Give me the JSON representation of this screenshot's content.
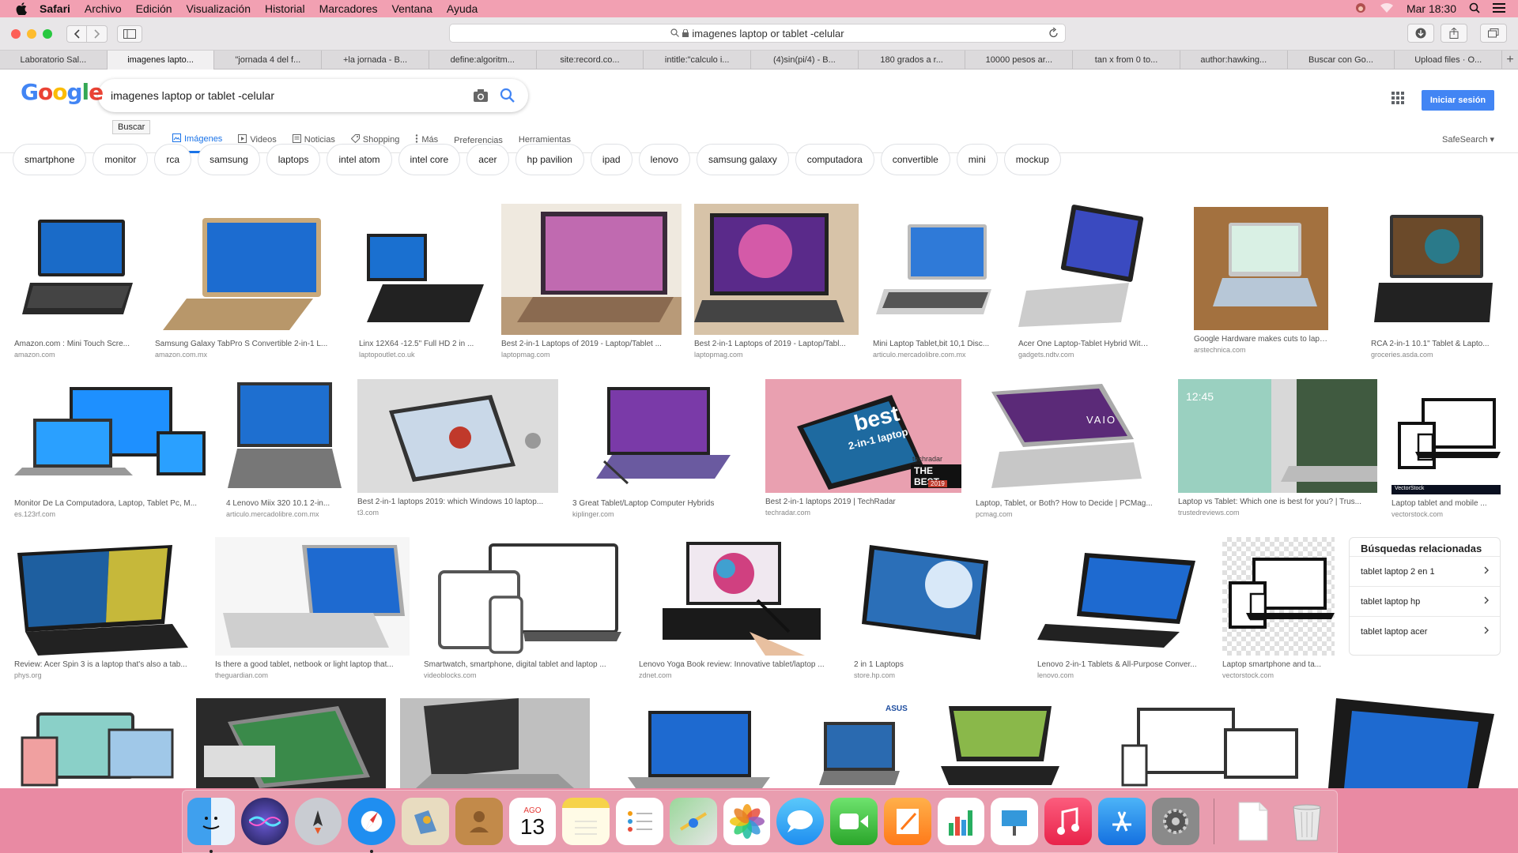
{
  "menubar": {
    "app": "Safari",
    "items": [
      "Archivo",
      "Edición",
      "Visualización",
      "Historial",
      "Marcadores",
      "Ventana",
      "Ayuda"
    ],
    "clock": "Mar 18:30"
  },
  "browser": {
    "address": "imagenes laptop or tablet -celular",
    "tabs": [
      "Laboratorio Sal...",
      "imagenes lapto...",
      "\"jornada 4 del f...",
      "+la jornada - B...",
      "define:algoritm...",
      "site:record.co...",
      "intitle:\"calculo i...",
      "(4)sin(pi/4) - B...",
      "180 grados a r...",
      "10000 pesos ar...",
      "tan x from 0 to...",
      "author:hawking...",
      "Buscar con Go...",
      "Upload files · O..."
    ]
  },
  "google": {
    "logo_letters": [
      "G",
      "o",
      "o",
      "g",
      "l",
      "e"
    ],
    "query": "imagenes laptop or tablet -celular",
    "tooltip": "Buscar",
    "nav_tabs": [
      "Imágenes",
      "Videos",
      "Noticias",
      "Shopping",
      "Más",
      "Preferencias",
      "Herramientas"
    ],
    "signin": "Iniciar sesión",
    "safesearch": "SafeSearch ▾"
  },
  "chips": [
    "smartphone",
    "monitor",
    "rca",
    "samsung",
    "laptops",
    "intel atom",
    "intel core",
    "acer",
    "hp pavilion",
    "ipad",
    "lenovo",
    "samsung galaxy",
    "computadora",
    "convertible",
    "mini",
    "mockup"
  ],
  "results": [
    {
      "caption": "Amazon.com : Mini Touch Scre...",
      "source": "amazon.com"
    },
    {
      "caption": "Samsung Galaxy TabPro S Convertible 2-in-1 L...",
      "source": "amazon.com.mx"
    },
    {
      "caption": "Linx 12X64 -12.5\" Full HD 2 in ...",
      "source": "laptopoutlet.co.uk"
    },
    {
      "caption": "Best 2-in-1 Laptops of 2019 - Laptop/Tablet ...",
      "source": "laptopmag.com"
    },
    {
      "caption": "Best 2-in-1 Laptops of 2019 - Laptop/Tabl...",
      "source": "laptopmag.com"
    },
    {
      "caption": "Mini Laptop Tablet,bit 10,1 Disc...",
      "source": "articulo.mercadolibre.com.mx"
    },
    {
      "caption": "Acer One Laptop-Tablet Hybrid With Win...",
      "source": "gadgets.ndtv.com"
    },
    {
      "caption": "Google Hardware makes cuts to laptop a...",
      "source": "arstechnica.com"
    },
    {
      "caption": "RCA 2-in-1 10.1\" Tablet & Lapto...",
      "source": "groceries.asda.com"
    },
    {
      "caption": "Monitor De La Computadora, Laptop, Tablet Pc, M...",
      "source": "es.123rf.com"
    },
    {
      "caption": "4 Lenovo Miix 320 10.1 2-in...",
      "source": "articulo.mercadolibre.com.mx"
    },
    {
      "caption": "Best 2-in-1 laptops 2019: which Windows 10 laptop...",
      "source": "t3.com"
    },
    {
      "caption": "3 Great Tablet/Laptop Computer Hybrids",
      "source": "kiplinger.com"
    },
    {
      "caption": "Best 2-in-1 laptops 2019 | TechRadar",
      "source": "techradar.com"
    },
    {
      "caption": "Laptop, Tablet, or Both? How to Decide | PCMag...",
      "source": "pcmag.com"
    },
    {
      "caption": "Laptop vs Tablet: Which one is best for you? | Trus...",
      "source": "trustedreviews.com"
    },
    {
      "caption": "Laptop tablet and mobile ...",
      "source": "vectorstock.com"
    },
    {
      "caption": "Review: Acer Spin 3 is a laptop that's also a tab...",
      "source": "phys.org"
    },
    {
      "caption": "Is there a good tablet, netbook or light laptop that...",
      "source": "theguardian.com"
    },
    {
      "caption": "Smartwatch, smartphone, digital tablet and laptop ...",
      "source": "videoblocks.com"
    },
    {
      "caption": "Lenovo Yoga Book review: Innovative tablet/laptop ...",
      "source": "zdnet.com"
    },
    {
      "caption": "2 in 1 Laptops",
      "source": "store.hp.com"
    },
    {
      "caption": "Lenovo 2-in-1 Tablets & All-Purpose Conver...",
      "source": "lenovo.com"
    },
    {
      "caption": "Laptop smartphone and ta...",
      "source": "vectorstock.com"
    }
  ],
  "thumb_text": {
    "best": "best",
    "two_in_one": "2-in-1 laptop",
    "techradar": "techradar",
    "the_best": "THE BEST.",
    "year": "2019",
    "vaio": "VAIO",
    "clock": "12:45",
    "vectorstock": "VectorStock",
    "asus": "ASUS"
  },
  "related": {
    "heading": "Búsquedas relacionadas",
    "items": [
      "tablet laptop 2 en 1",
      "tablet laptop hp",
      "tablet laptop acer"
    ]
  },
  "dock": {
    "calendar_month": "AGO",
    "calendar_day": "13",
    "apps": [
      "finder-icon",
      "siri-icon",
      "launchpad-icon",
      "safari-icon",
      "mail-icon",
      "contacts-icon",
      "calendar-icon",
      "notes-icon",
      "reminders-icon",
      "maps-icon",
      "photos-icon",
      "messages-icon",
      "facetime-icon",
      "pages-icon",
      "numbers-icon",
      "keynote-icon",
      "music-icon",
      "app-store-icon",
      "system-preferences-icon",
      "document-icon",
      "trash-icon"
    ]
  }
}
